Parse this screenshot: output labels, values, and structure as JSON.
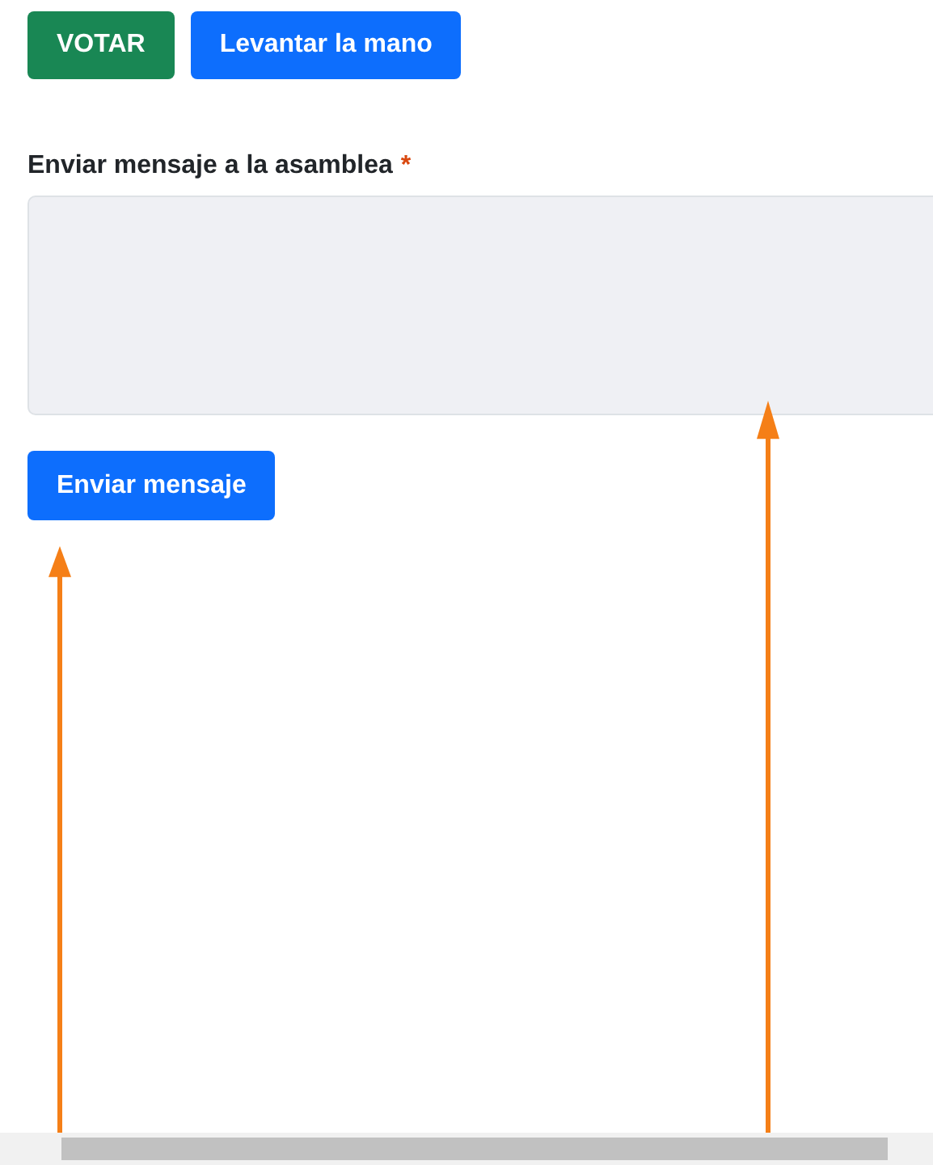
{
  "actions": [
    {
      "label": "VOTAR",
      "kind": "success"
    },
    {
      "label": "Levantar la mano",
      "kind": "primary"
    }
  ],
  "message": {
    "label": "Enviar mensaje a la asamblea",
    "required_mark": "*",
    "submit": "Enviar mensaje"
  },
  "annotations": [
    {
      "kind": "arrow"
    },
    {
      "kind": "arrow"
    }
  ]
}
